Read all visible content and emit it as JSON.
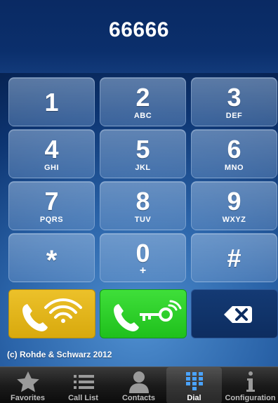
{
  "display": {
    "number": "66666"
  },
  "keypad": {
    "keys": [
      {
        "digit": "1",
        "letters": ""
      },
      {
        "digit": "2",
        "letters": "ABC"
      },
      {
        "digit": "3",
        "letters": "DEF"
      },
      {
        "digit": "4",
        "letters": "GHI"
      },
      {
        "digit": "5",
        "letters": "JKL"
      },
      {
        "digit": "6",
        "letters": "MNO"
      },
      {
        "digit": "7",
        "letters": "PQRS"
      },
      {
        "digit": "8",
        "letters": "TUV"
      },
      {
        "digit": "9",
        "letters": "WXYZ"
      },
      {
        "digit": "*",
        "letters": ""
      },
      {
        "digit": "0",
        "letters": "+"
      },
      {
        "digit": "#",
        "letters": ""
      }
    ]
  },
  "actions": {
    "call_wifi_icon": "phone-wifi-icon",
    "call_secure_icon": "phone-key-icon",
    "backspace_icon": "backspace-icon",
    "colors": {
      "wifi_call": "#e3b51b",
      "secure_call": "#2fd22a",
      "backspace": "#0f3166"
    }
  },
  "footer": {
    "copyright": "(c) Rohde & Schwarz 2012"
  },
  "tabbar": {
    "active": "Dial",
    "tabs": [
      {
        "label": "Favorites",
        "icon": "star-icon"
      },
      {
        "label": "Call List",
        "icon": "list-icon"
      },
      {
        "label": "Contacts",
        "icon": "person-icon"
      },
      {
        "label": "Dial",
        "icon": "keypad-icon"
      },
      {
        "label": "Configuration",
        "icon": "info-icon"
      }
    ]
  }
}
